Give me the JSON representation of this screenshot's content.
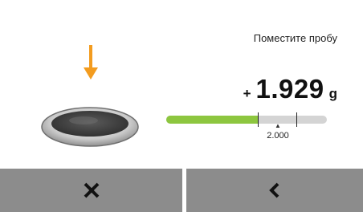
{
  "instruction": "Поместите пробу",
  "weight": {
    "sign": "+",
    "value": "1.929",
    "unit": "g"
  },
  "progress": {
    "fraction": 0.57,
    "tolerance_low_fraction": 0.57,
    "tolerance_high_fraction": 0.81,
    "target_label": "2.000"
  },
  "colors": {
    "arrow": "#f39c1f",
    "progress_fill": "#8dc63f",
    "progress_track": "#d4d4d4",
    "footer_button": "#8c8c8c"
  },
  "icons": {
    "arrow": "arrow-down-icon",
    "dish": "sample-dish-icon",
    "cancel": "close-icon",
    "back": "chevron-left-icon"
  }
}
